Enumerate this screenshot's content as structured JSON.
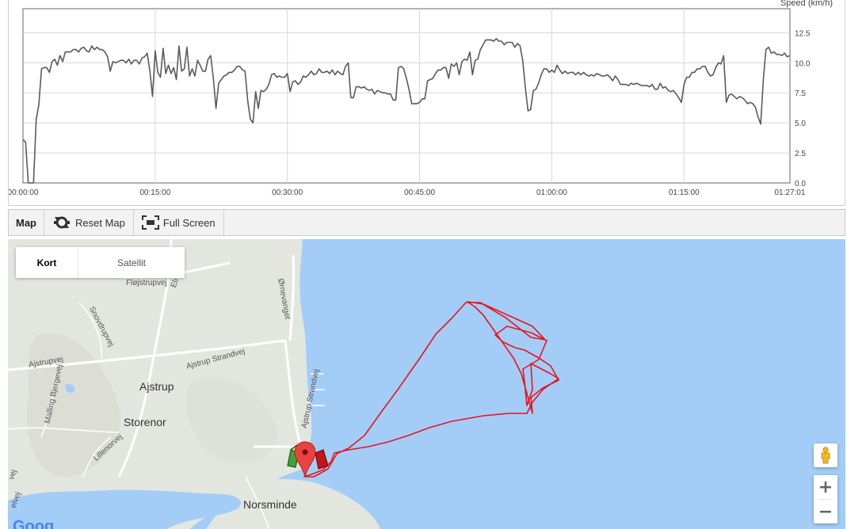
{
  "chart_data": {
    "type": "line",
    "ylabel": "Speed (km/h)",
    "ylim": [
      0,
      14.5
    ],
    "yticks": [
      "0.0",
      "2.5",
      "5.0",
      "7.5",
      "10.0",
      "12.5"
    ],
    "xticks": [
      "00:00:00",
      "00:15:00",
      "00:30:00",
      "00:45:00",
      "01:00:00",
      "01:15:00",
      "01:27:01"
    ],
    "xlim_min": [
      0,
      87.02
    ],
    "grid": true,
    "series": [
      {
        "x_min": [
          0,
          0.3,
          0.6,
          0.9,
          1.2,
          1.5,
          1.8,
          2.1,
          2.4,
          2.7,
          3,
          3.3,
          3.6,
          3.9,
          4.2,
          4.5,
          4.8,
          5.1,
          5.4,
          5.7,
          6,
          6.3,
          6.6,
          6.9,
          7.2,
          7.5,
          7.8,
          8.1,
          8.4,
          8.7,
          9,
          9.3,
          9.6,
          9.9,
          10.2,
          10.5,
          10.8,
          11.1,
          11.4,
          11.7,
          12,
          12.3,
          12.6,
          12.9,
          13.2,
          13.5,
          13.8,
          14.1,
          14.4,
          14.7,
          15,
          15.3,
          15.6,
          15.9,
          16.2,
          16.5,
          16.8,
          17.1,
          17.4,
          17.7,
          18,
          18.3,
          18.6,
          18.9,
          19.2,
          19.5,
          19.8,
          20.1,
          20.4,
          20.7,
          21,
          21.3,
          21.6,
          21.9,
          22.2,
          22.5,
          22.8,
          23.1,
          23.4,
          23.7,
          24,
          24.3,
          24.6,
          24.9,
          25.2,
          25.5,
          25.8,
          26.1,
          26.4,
          26.7,
          27,
          27.3,
          27.6,
          27.9,
          28.2,
          28.5,
          28.8,
          29.1,
          29.4,
          29.7,
          30,
          30.3,
          30.6,
          30.9,
          31.2,
          31.5,
          31.8,
          32.1,
          32.4,
          32.7,
          33,
          33.3,
          33.6,
          33.9,
          34.2,
          34.5,
          34.8,
          35.1,
          35.4,
          35.7,
          36,
          36.3,
          36.6,
          36.9,
          37.2,
          37.5,
          37.8,
          38.1,
          38.4,
          38.7,
          39,
          39.3,
          39.6,
          39.9,
          40.2,
          40.5,
          40.8,
          41.1,
          41.4,
          41.7,
          42,
          42.3,
          42.6,
          42.9,
          43.2,
          43.5,
          43.8,
          44.1,
          44.4,
          44.7,
          45,
          45.3,
          45.6,
          45.9,
          46.2,
          46.5,
          46.8,
          47.1,
          47.4,
          47.7,
          48,
          48.3,
          48.6,
          48.9,
          49.2,
          49.5,
          49.8,
          50.1,
          50.4,
          50.7,
          51,
          51.3,
          51.6,
          51.9,
          52.2,
          52.5,
          52.8,
          53.1,
          53.4,
          53.7,
          54,
          54.3,
          54.6,
          54.9,
          55.2,
          55.5,
          55.8,
          56.1,
          56.4,
          56.7,
          57,
          57.3,
          57.6,
          57.9,
          58.2,
          58.5,
          58.8,
          59.1,
          59.4,
          59.7,
          60,
          60.3,
          60.6,
          60.9,
          61.2,
          61.5,
          61.8,
          62.1,
          62.4,
          62.7,
          63,
          63.3,
          63.6,
          63.9,
          64.2,
          64.5,
          64.8,
          65.1,
          65.4,
          65.7,
          66,
          66.3,
          66.6,
          66.9,
          67.2,
          67.5,
          67.8,
          68.1,
          68.4,
          68.7,
          69,
          69.3,
          69.6,
          69.9,
          70.2,
          70.5,
          70.8,
          71.1,
          71.4,
          71.7,
          72,
          72.3,
          72.6,
          72.9,
          73.2,
          73.5,
          73.8,
          74.1,
          74.4,
          74.7,
          75,
          75.3,
          75.6,
          75.9,
          76.2,
          76.5,
          76.8,
          77.1,
          77.4,
          77.7,
          78,
          78.3,
          78.6,
          78.9,
          79.2,
          79.5,
          79.8,
          80.1,
          80.4,
          80.7,
          81,
          81.3,
          81.6,
          81.9,
          82.2,
          82.5,
          82.8,
          83.1,
          83.4,
          83.7,
          84,
          84.3,
          84.6,
          84.9,
          85.2,
          85.5,
          85.8,
          86.1,
          86.4,
          86.7,
          87
        ],
        "y": [
          3.6,
          3.4,
          0,
          0,
          0,
          5.3,
          6.5,
          9.5,
          9.6,
          9.6,
          9.2,
          10.1,
          10.3,
          9.8,
          10.6,
          10.1,
          10.9,
          10.9,
          10.9,
          11.1,
          11.1,
          10.9,
          11.2,
          11.3,
          11,
          10.9,
          11.4,
          11.1,
          11.3,
          11.1,
          11.1,
          10.9,
          10.5,
          9.3,
          10.1,
          10,
          10.1,
          10.2,
          10.2,
          10,
          10.3,
          9.9,
          10.2,
          10.2,
          9.9,
          10.4,
          10.5,
          10.8,
          9.3,
          7.2,
          11,
          9.2,
          8.8,
          11.2,
          9.1,
          9.8,
          9.1,
          9.6,
          8.6,
          11.4,
          9.3,
          9.5,
          11.3,
          8.9,
          9.5,
          8.9,
          10.2,
          9.8,
          9.3,
          9.3,
          10.3,
          10.6,
          8.7,
          6.2,
          8.3,
          8.6,
          8.9,
          9,
          9.2,
          9.2,
          9.4,
          9.7,
          9.7,
          9.4,
          9.3,
          6.8,
          5.3,
          5,
          7.6,
          6.2,
          7.7,
          7.6,
          7.8,
          8.2,
          9,
          9.1,
          8.8,
          8.9,
          8.8,
          8.8,
          9.1,
          7.6,
          8.4,
          8.5,
          8.2,
          8.4,
          8.9,
          8.8,
          9,
          9.3,
          9,
          9.1,
          9.5,
          9.2,
          9.2,
          9.3,
          9.1,
          9.4,
          9,
          9.3,
          9.1,
          9,
          9.7,
          10,
          7.1,
          7.1,
          8,
          8,
          7.9,
          8,
          7.8,
          7.7,
          7.8,
          7.4,
          7.7,
          7.6,
          7.5,
          7.5,
          7.4,
          7.4,
          6.9,
          6.9,
          9.6,
          9.7,
          9.5,
          8.7,
          7.8,
          6.6,
          6.6,
          6.6,
          6.7,
          7,
          7,
          8.5,
          8.6,
          8.7,
          9.1,
          9.4,
          9.4,
          9.6,
          9.6,
          8.7,
          9.9,
          9.7,
          10,
          9,
          10.1,
          10.3,
          10.2,
          10.9,
          9,
          10.2,
          10.3,
          11.1,
          11.5,
          11.9,
          11.9,
          11.9,
          11.8,
          12,
          11.8,
          11.8,
          11.5,
          11.7,
          11.7,
          11.7,
          11.3,
          11.6,
          11.4,
          10.2,
          7.9,
          6,
          6.1,
          7.7,
          7.8,
          8.3,
          9,
          9.5,
          9.5,
          9.2,
          9.4,
          9.2,
          9.8,
          9.4,
          9.1,
          9.3,
          9.1,
          9.2,
          9.2,
          9,
          9.2,
          9,
          9.2,
          9,
          8.9,
          9,
          8.9,
          9.1,
          9,
          8.9,
          8.9,
          9,
          8.8,
          8.5,
          8.9,
          8.6,
          8.2,
          8.2,
          8.2,
          8.1,
          8.3,
          8.2,
          8.3,
          8.2,
          8.1,
          8.1,
          8.1,
          8,
          8.2,
          7.8,
          7.8,
          8.3,
          7.9,
          8,
          7.7,
          7.6,
          7.7,
          7.4,
          7.1,
          6.7,
          8.2,
          8.8,
          8.8,
          9.2,
          9.2,
          9.5,
          9.5,
          9.7,
          9.7,
          9.2,
          8.9,
          9,
          9.6,
          10,
          9.9,
          10.6,
          6.7,
          7.3,
          7.4,
          7.2,
          7,
          7.2,
          7.1,
          6.9,
          6.6,
          6.7,
          6.6,
          6.3,
          5.5,
          4.9,
          8.6,
          11.1,
          11.3,
          10.8,
          10.9,
          10.7,
          10.7,
          10.6,
          10.8,
          10.5,
          10.6,
          10.7,
          10.5,
          10.5,
          10.3,
          10.2,
          10.1,
          10.1,
          10.4
        ]
      }
    ]
  },
  "toolbar": {
    "title": "Map",
    "reset_label": "Reset Map",
    "reset_icon": "reset-map-icon",
    "fullscreen_label": "Full Screen",
    "fullscreen_icon": "fullscreen-icon"
  },
  "map": {
    "type_active": "Kort",
    "type_inactive": "Satellit",
    "labels": {
      "flojstrupvej": "Fløjstrupvej",
      "el": "Elı",
      "ornevanget": "Ørnevanget",
      "snovdrupvej": "Snovdrupvej",
      "ajstrupvej": "Ajstrupvej",
      "ajstrup_strandvej_w": "Ajstrup Strandvej",
      "ajstrup_strandvej_n": "Ajstrup Strandvej",
      "malling_bjergevej": "Malling Bjergevej",
      "ajstrup": "Ajstrup",
      "storenor": "Storenor",
      "lillenorvej": "Lillenorvej",
      "norsminde": "Norsminde",
      "vej1": "vej",
      "vej2": "elvej",
      "google": "Goog"
    },
    "zoom_in": "+",
    "zoom_out": "−"
  },
  "colors": {
    "water": "#a3cdf7",
    "land": "#e4e7e0",
    "track": "#e8141c",
    "line": "#555555",
    "start_flag": "#3ea33a",
    "finish_flag": "#c7131a",
    "pin": "#e9433f"
  }
}
